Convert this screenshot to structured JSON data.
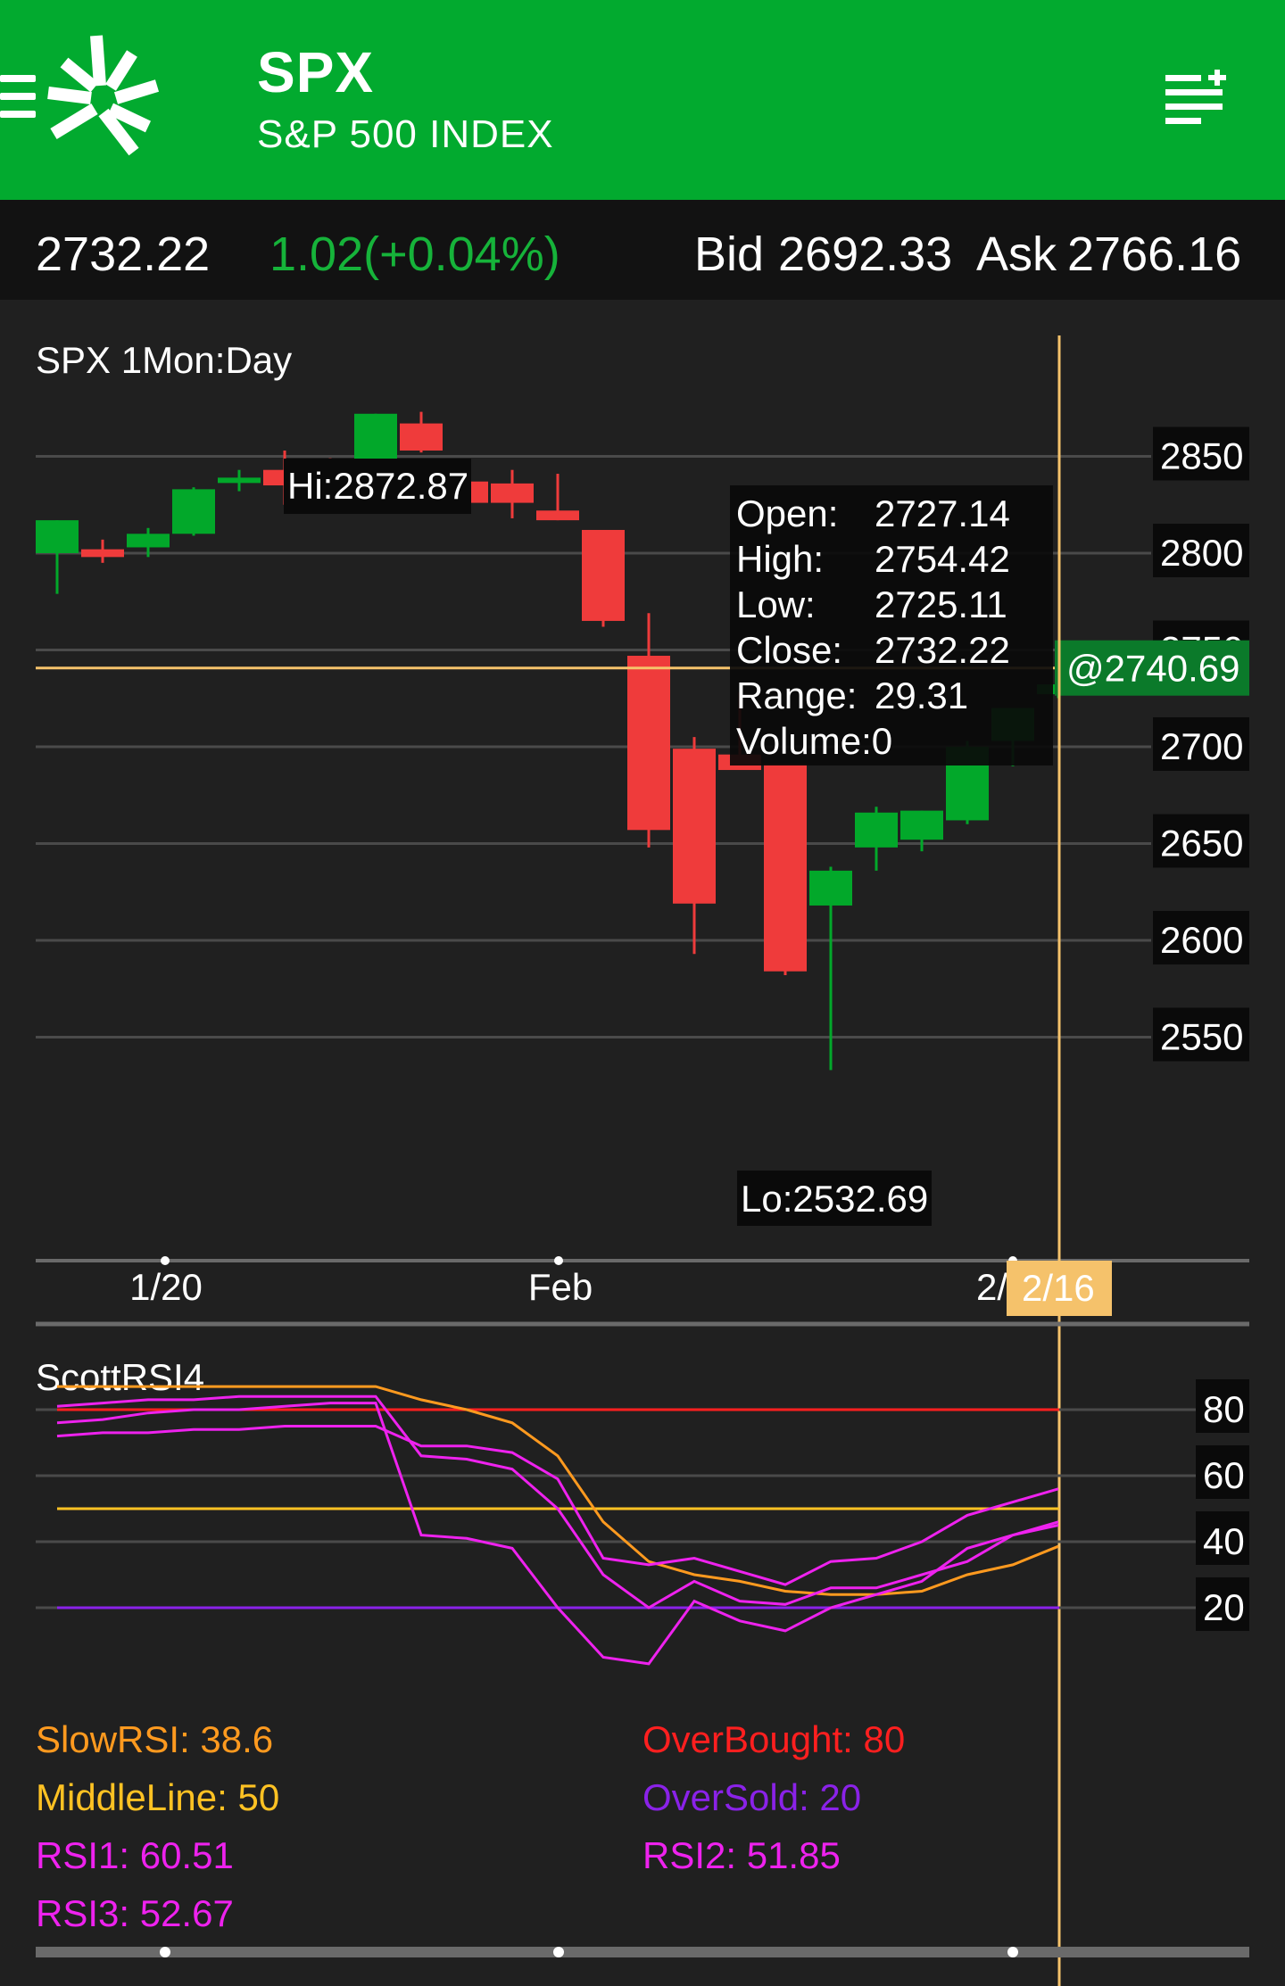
{
  "header": {
    "symbol": "SPX",
    "name": "S&P 500 INDEX",
    "bg_color": "#02aa2f",
    "icons": [
      "menu-icon",
      "logo-icon",
      "add-list-icon"
    ]
  },
  "quote": {
    "last": "2732.22",
    "change": "1.02(+0.04%)",
    "bid_label": "Bid",
    "bid": "2692.33",
    "ask_label": "Ask",
    "ask": "2766.16",
    "up_color": "#16b33a"
  },
  "main_chart": {
    "title": "SPX 1Mon:Day",
    "hi_label": "Hi:2872.87",
    "lo_label": "Lo:2532.69",
    "crosshair_price_label": "@2740.69",
    "crosshair_price": 2740.69,
    "crosshair_date_label": "2/16",
    "x_ticks": [
      "1/20",
      "Feb",
      "2/"
    ],
    "tooltip": {
      "open_label": "Open:",
      "open": "2727.14",
      "high_label": "High:",
      "high": "2754.42",
      "low_label": "Low:",
      "low": "2725.11",
      "close_label": "Close:",
      "close": "2732.22",
      "range_label": "Range:",
      "range": "29.31",
      "volume_label": "Volume:",
      "volume": "0"
    },
    "colors": {
      "up": "#02a82a",
      "down": "#ef3b3b",
      "crosshair": "#f5c26b"
    }
  },
  "chart_data": [
    {
      "type": "candlestick",
      "title": "SPX 1Mon:Day",
      "y_ticks": [
        2850,
        2800,
        2750,
        2700,
        2650,
        2600,
        2550
      ],
      "ylim": [
        2505,
        2905
      ],
      "candles": [
        {
          "o": 2800,
          "h": 2806,
          "l": 2779,
          "c": 2817
        },
        {
          "o": 2802,
          "h": 2807,
          "l": 2795,
          "c": 2798
        },
        {
          "o": 2803,
          "h": 2813,
          "l": 2798,
          "c": 2810
        },
        {
          "o": 2810,
          "h": 2834,
          "l": 2809,
          "c": 2833
        },
        {
          "o": 2837,
          "h": 2843,
          "l": 2832,
          "c": 2839
        },
        {
          "o": 2843,
          "h": 2853,
          "l": 2825,
          "c": 2835
        },
        {
          "o": 2844,
          "h": 2849,
          "l": 2830,
          "c": 2838
        },
        {
          "o": 2846,
          "h": 2872,
          "l": 2846,
          "c": 2872
        },
        {
          "o": 2867,
          "h": 2873,
          "l": 2852,
          "c": 2853
        },
        {
          "o": 2837,
          "h": 2842,
          "l": 2821,
          "c": 2826
        },
        {
          "o": 2836,
          "h": 2843,
          "l": 2818,
          "c": 2826
        },
        {
          "o": 2822,
          "h": 2841,
          "l": 2817,
          "c": 2817
        },
        {
          "o": 2812,
          "h": 2812,
          "l": 2762,
          "c": 2765
        },
        {
          "o": 2747,
          "h": 2769,
          "l": 2648,
          "c": 2657
        },
        {
          "o": 2699,
          "h": 2705,
          "l": 2593,
          "c": 2619
        },
        {
          "o": 2696,
          "h": 2728,
          "l": 2692,
          "c": 2688
        },
        {
          "o": 2691,
          "h": 2690,
          "l": 2582,
          "c": 2584
        },
        {
          "o": 2618,
          "h": 2638,
          "l": 2533,
          "c": 2636
        },
        {
          "o": 2648,
          "h": 2669,
          "l": 2636,
          "c": 2666
        },
        {
          "o": 2652,
          "h": 2666,
          "l": 2646,
          "c": 2667
        },
        {
          "o": 2662,
          "h": 2703,
          "l": 2660,
          "c": 2700
        },
        {
          "o": 2703,
          "h": 2708,
          "l": 2690,
          "c": 2720
        },
        {
          "o": 2727.14,
          "h": 2754.42,
          "l": 2725.11,
          "c": 2732.22
        }
      ]
    },
    {
      "type": "line",
      "title": "ScottRSI4",
      "y_ticks": [
        80,
        60,
        40,
        20
      ],
      "ylim": [
        0,
        100
      ],
      "series": [
        {
          "name": "SlowRSI",
          "value_label": "38.6",
          "color": "#ff9a1f",
          "values": [
            87,
            87,
            87,
            87,
            87,
            87,
            87,
            87,
            83,
            80,
            76,
            66,
            46,
            34,
            30,
            28,
            25,
            24,
            24,
            25,
            30,
            33,
            38.6
          ]
        },
        {
          "name": "RSI1",
          "value_label": "60.51",
          "color": "#ee22ee",
          "values": [
            76,
            77,
            79,
            80,
            80,
            81,
            82,
            82,
            42,
            41,
            38,
            20,
            5,
            3,
            22,
            16,
            13,
            20,
            24,
            28,
            38,
            42,
            45
          ]
        },
        {
          "name": "RSI2",
          "value_label": "51.85",
          "color": "#ee22ee",
          "values": [
            81,
            82,
            83,
            83,
            84,
            84,
            84,
            84,
            66,
            65,
            62,
            50,
            30,
            20,
            28,
            22,
            21,
            26,
            26,
            30,
            34,
            42,
            46
          ]
        },
        {
          "name": "RSI3",
          "value_label": "52.67",
          "color": "#ee22ee",
          "values": [
            72,
            73,
            73,
            74,
            74,
            75,
            75,
            75,
            69,
            69,
            67,
            59,
            35,
            33,
            35,
            31,
            27,
            34,
            35,
            40,
            48,
            52,
            56
          ]
        }
      ],
      "levels": [
        {
          "name": "OverBought",
          "value_label": "80",
          "value": 80,
          "color": "#ff1f1f"
        },
        {
          "name": "MiddleLine",
          "value_label": "50",
          "value": 50,
          "color": "#ffc223"
        },
        {
          "name": "OverSold",
          "value_label": "20",
          "value": 20,
          "color": "#8a22e8"
        }
      ]
    }
  ]
}
